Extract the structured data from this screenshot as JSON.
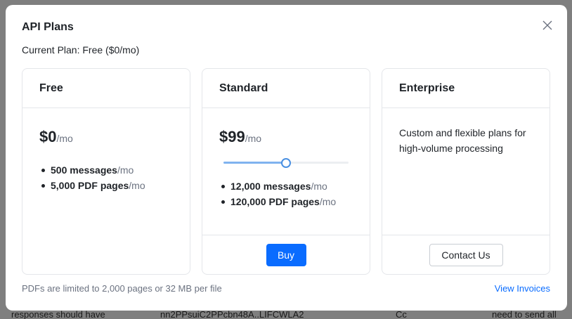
{
  "background": {
    "bottom_segments": [
      "responses should have",
      "nn2PPsuiC2PPcbn48A..LIFCWLA2",
      "Cc",
      "need to send all"
    ]
  },
  "modal": {
    "title": "API Plans",
    "current_plan": "Current Plan: Free ($0/mo)",
    "close_icon": "close-x-icon",
    "footer_note": "PDFs are limited to 2,000 pages or 32 MB per file",
    "view_invoices": "View Invoices"
  },
  "plans": {
    "free": {
      "name": "Free",
      "price": "$0",
      "per": "/mo",
      "features": [
        {
          "qty": "500 messages",
          "unit": "/mo"
        },
        {
          "qty": "5,000 PDF pages",
          "unit": "/mo"
        }
      ]
    },
    "standard": {
      "name": "Standard",
      "price": "$99",
      "per": "/mo",
      "slider_level": 0.5,
      "features": [
        {
          "qty": "12,000 messages",
          "unit": "/mo"
        },
        {
          "qty": "120,000 PDF pages",
          "unit": "/mo"
        }
      ],
      "button": "Buy"
    },
    "enterprise": {
      "name": "Enterprise",
      "description": "Custom and flexible plans for high-volume processing",
      "button": "Contact Us"
    }
  },
  "colors": {
    "accent": "#0a6cff",
    "slider_fill": "#7fb3ef",
    "slider_thumb": "#4a90e2"
  }
}
